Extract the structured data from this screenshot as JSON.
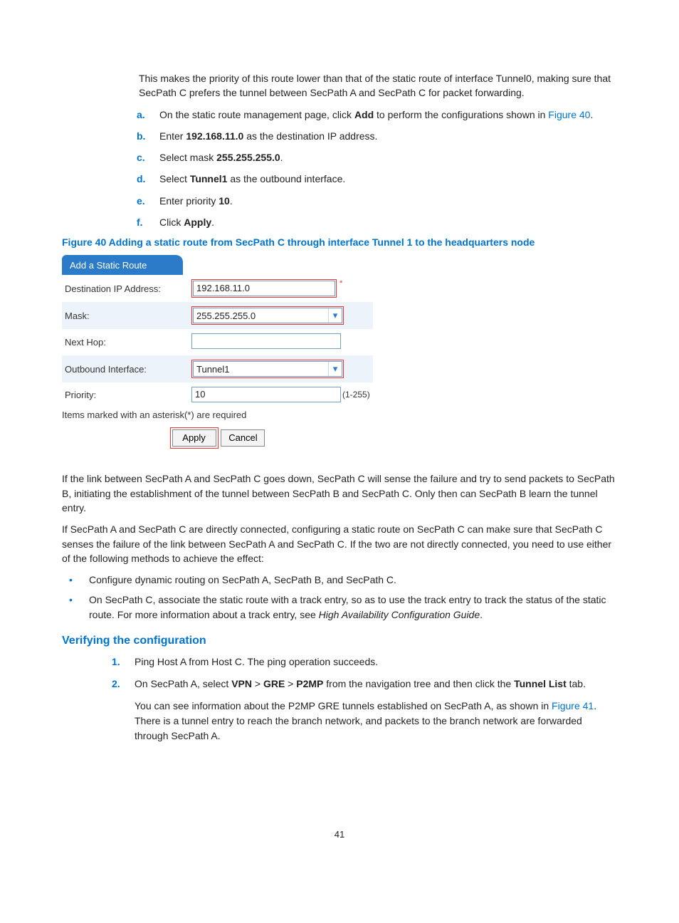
{
  "intro": "This makes the priority of this route lower than that of the static route of interface Tunnel0, making sure that SecPath C prefers the tunnel between SecPath A and SecPath C for packet forwarding.",
  "steps_alpha": {
    "a": {
      "pre": "On the static route management page, click ",
      "bold": "Add",
      "post": " to perform the configurations shown in ",
      "link": "Figure 40",
      "end": "."
    },
    "b": {
      "pre": "Enter ",
      "bold": "192.168.11.0",
      "post": " as the destination IP address."
    },
    "c": {
      "pre": "Select mask ",
      "bold": "255.255.255.0",
      "post": "."
    },
    "d": {
      "pre": "Select ",
      "bold": "Tunnel1",
      "post": " as the outbound interface."
    },
    "e": {
      "pre": "Enter priority ",
      "bold": "10",
      "post": "."
    },
    "f": {
      "pre": "Click ",
      "bold": "Apply",
      "post": "."
    }
  },
  "figure_caption": "Figure 40 Adding a static route from SecPath C through interface Tunnel 1 to the headquarters node",
  "form": {
    "tab": "Add a Static Route",
    "labels": {
      "dest": "Destination IP Address:",
      "mask": "Mask:",
      "next": "Next Hop:",
      "out": "Outbound Interface:",
      "prio": "Priority:"
    },
    "values": {
      "dest": "192.168.11.0",
      "mask": "255.255.255.0",
      "next": "",
      "out": "Tunnel1",
      "prio": "10"
    },
    "range": "(1-255)",
    "note": "Items marked with an asterisk(*) are required",
    "apply": "Apply",
    "cancel": "Cancel"
  },
  "para2": "If the link between SecPath A and SecPath C goes down, SecPath C will sense the failure and try to send packets to SecPath B, initiating the establishment of the tunnel between SecPath B and SecPath C. Only then can SecPath B learn the tunnel entry.",
  "para3": "If SecPath A and SecPath C are directly connected, configuring a static route on SecPath C can make sure that SecPath C senses the failure of the link between SecPath A and SecPath C. If the two are not directly connected, you need to use either of the following methods to achieve the effect:",
  "bullets": {
    "b1": "Configure dynamic routing on SecPath A, SecPath B, and SecPath C.",
    "b2_pre": "On SecPath C, associate the static route with a track entry, so as to use the track entry to track the status of the static route. For more information about a track entry, see ",
    "b2_italic": "High Availability Configuration Guide",
    "b2_post": "."
  },
  "verify_heading": "Verifying the configuration",
  "verify": {
    "s1": "Ping Host A from Host C. The ping operation succeeds.",
    "s2_pre": "On SecPath A, select ",
    "s2_vpn": "VPN",
    "s2_gre": "GRE",
    "s2_p2mp": "P2MP",
    "s2_mid": " from the navigation tree and then click the ",
    "s2_tunnel": "Tunnel List",
    "s2_post": " tab.",
    "s2_sub_pre": "You can see information about the P2MP GRE tunnels established on SecPath A, as shown in ",
    "s2_link": "Figure 41",
    "s2_sub_post": ". There is a tunnel entry to reach the branch network, and packets to the branch network are forwarded through SecPath A."
  },
  "pagenum": "41"
}
